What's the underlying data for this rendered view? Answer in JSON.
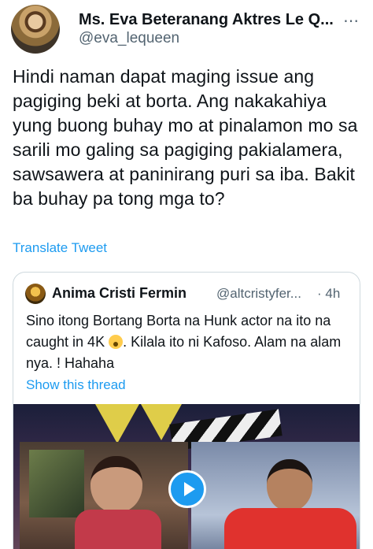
{
  "tweet": {
    "author": {
      "display_name": "Ms. Eva Beteranang Aktres Le Q...",
      "handle": "@eva_lequeen"
    },
    "text": "Hindi naman dapat maging issue ang pagiging beki at borta. Ang nakakahiya yung buong buhay mo at pinalamon mo sa sarili mo galing sa pagiging pakialamera, sawsawera at paninirang puri sa iba. Bakit ba buhay pa tong mga to?",
    "translate_label": "Translate Tweet",
    "more_icon": "more-dots-icon"
  },
  "quoted_tweet": {
    "author": {
      "display_name": "Anima Cristi Fermin",
      "handle": "@altcristyfer...",
      "time": "· 4h"
    },
    "text_before_emoji": "Sino itong Bortang Borta na Hunk actor na ito na caught in 4K ",
    "emoji": "screaming-face-emoji",
    "text_after_emoji": ". Kilala ito ni Kafoso. Alam na alam nya. ! Hahaha",
    "show_thread_label": "Show this thread",
    "media": {
      "type": "video",
      "play_icon": "play-icon"
    }
  },
  "colors": {
    "link": "#1d9bf0",
    "secondary_text": "#536471",
    "border": "#cfd9de"
  }
}
